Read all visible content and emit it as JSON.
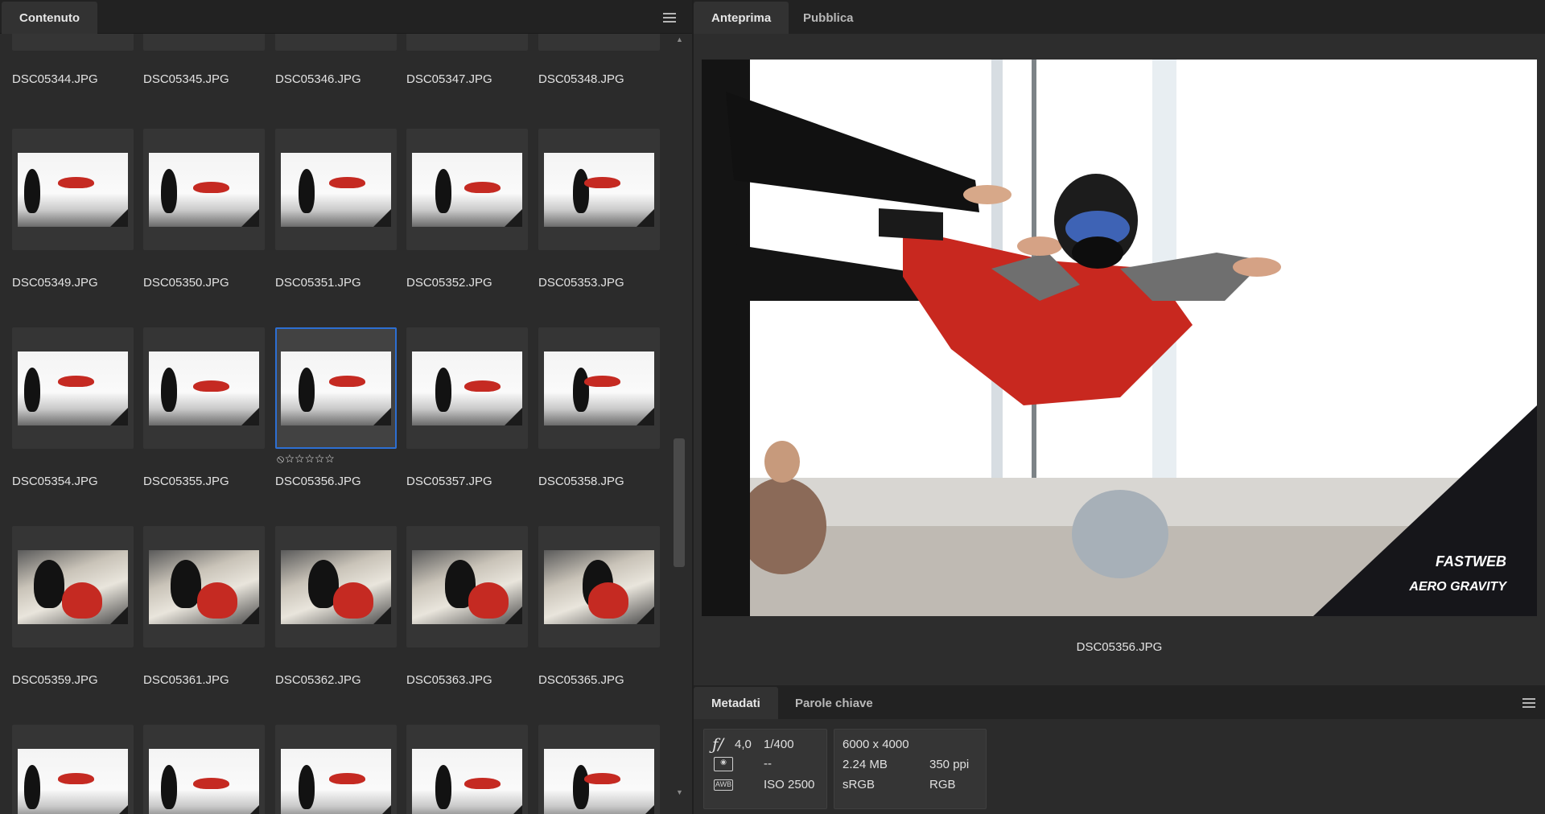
{
  "left_panel": {
    "tab_label": "Contenuto"
  },
  "grid": {
    "top_row_partial": [
      "DSC05344.JPG",
      "DSC05345.JPG",
      "DSC05346.JPG",
      "DSC05347.JPG",
      "DSC05348.JPG"
    ],
    "rows": [
      [
        "DSC05349.JPG",
        "DSC05350.JPG",
        "DSC05351.JPG",
        "DSC05352.JPG",
        "DSC05353.JPG"
      ],
      [
        "DSC05354.JPG",
        "DSC05355.JPG",
        "DSC05356.JPG",
        "DSC05357.JPG",
        "DSC05358.JPG"
      ],
      [
        "DSC05359.JPG",
        "DSC05361.JPG",
        "DSC05362.JPG",
        "DSC05363.JPG",
        "DSC05365.JPG"
      ]
    ],
    "selected": "DSC05356.JPG",
    "rating_text": "⦸☆☆☆☆☆"
  },
  "preview_panel": {
    "tabs": [
      "Anteprima",
      "Pubblica"
    ],
    "caption": "DSC05356.JPG",
    "watermark_line1": "FASTWEB",
    "watermark_line2": "AERO GRAVITY"
  },
  "metadata_panel": {
    "tabs": [
      "Metadati",
      "Parole chiave"
    ],
    "aperture": "4,0",
    "aperture_symbol": "ƒ/",
    "shutter": "1/400",
    "metering": "--",
    "iso": "ISO 2500",
    "wb_icon": "AWB",
    "dimensions": "6000 x 4000",
    "file_size": "2.24 MB",
    "resolution": "350 ppi",
    "color_profile": "sRGB",
    "color_mode": "RGB"
  },
  "colors": {
    "selection": "#2d6fd2",
    "panel_bg": "#2b2b2b",
    "tab_bg": "#222222"
  }
}
